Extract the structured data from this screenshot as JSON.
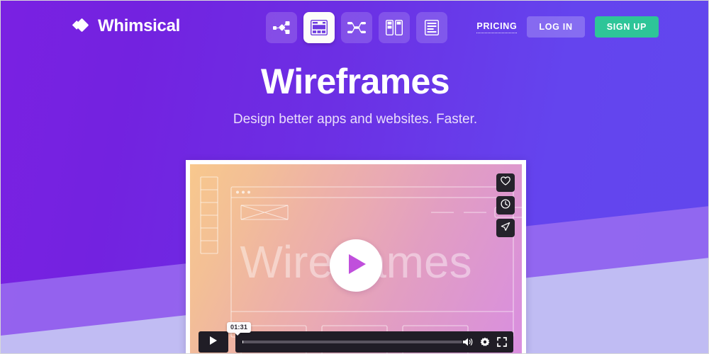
{
  "brand": {
    "name": "Whimsical",
    "logo_icon": "whimsical-diamond-logo"
  },
  "nav": {
    "items": [
      {
        "id": "flowcharts",
        "label": "Flowcharts",
        "icon": "flowchart-icon",
        "active": false
      },
      {
        "id": "wireframes",
        "label": "Wireframes",
        "icon": "wireframe-icon",
        "active": true
      },
      {
        "id": "mind-maps",
        "label": "Mind Maps",
        "icon": "mindmap-icon",
        "active": false
      },
      {
        "id": "sticky-notes",
        "label": "Sticky Notes",
        "icon": "sticky-notes-icon",
        "active": false
      },
      {
        "id": "docs",
        "label": "Docs",
        "icon": "docs-icon",
        "active": false
      }
    ],
    "pricing_label": "PRICING",
    "login_label": "LOG IN",
    "signup_label": "SIGN UP"
  },
  "hero": {
    "title": "Wireframes",
    "subtitle": "Design better apps and websites. Faster."
  },
  "video": {
    "poster_text": "Wireframes",
    "play_label": "Play",
    "time_tooltip": "01:31",
    "actions": [
      {
        "id": "like",
        "label": "Like",
        "icon": "heart-icon"
      },
      {
        "id": "later",
        "label": "Watch later",
        "icon": "clock-icon"
      },
      {
        "id": "share",
        "label": "Share",
        "icon": "share-paper-plane-icon"
      }
    ],
    "controls": [
      {
        "id": "play",
        "label": "Play",
        "icon": "play-icon"
      },
      {
        "id": "volume",
        "label": "Volume",
        "icon": "volume-icon"
      },
      {
        "id": "settings",
        "label": "Settings",
        "icon": "gear-icon"
      },
      {
        "id": "fullscreen",
        "label": "Fullscreen",
        "icon": "fullscreen-icon"
      }
    ]
  },
  "colors": {
    "background_left": "#7a21e2",
    "background_right": "#6147ed",
    "wave_mid": "#9a6df0",
    "wave_light": "#c3c1f2",
    "signup_green": "#2ec598",
    "play_purple": "#c04fdc",
    "poster_gradient_start": "#f8c88d",
    "poster_gradient_end": "#d98ee0"
  }
}
